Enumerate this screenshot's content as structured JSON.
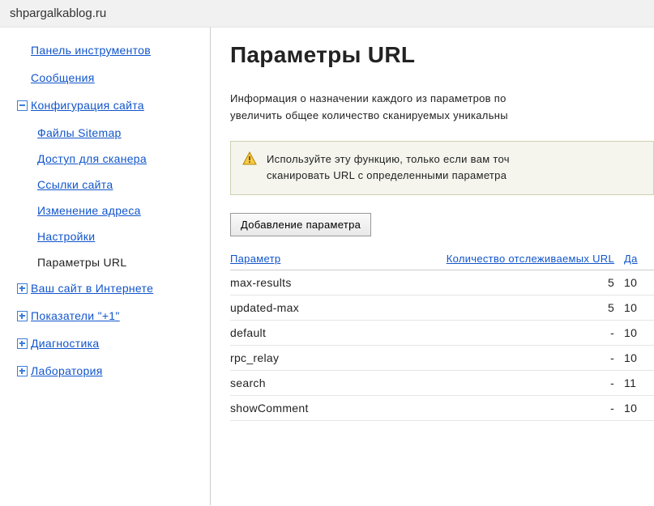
{
  "header": {
    "site": "shpargalkablog.ru"
  },
  "sidebar": {
    "items": [
      {
        "label": "Панель инструментов",
        "expand": null
      },
      {
        "label": "Сообщения",
        "expand": null
      },
      {
        "label": "Конфигурация сайта",
        "expand": "minus"
      },
      {
        "label": "Ваш сайт в Интернете",
        "expand": "plus"
      },
      {
        "label": "Показатели \"+1\"",
        "expand": "plus"
      },
      {
        "label": "Диагностика",
        "expand": "plus"
      },
      {
        "label": "Лаборатория",
        "expand": "plus"
      }
    ],
    "sub": [
      {
        "label": "Файлы Sitemap"
      },
      {
        "label": "Доступ для сканера"
      },
      {
        "label": "Ссылки сайта"
      },
      {
        "label": "Изменение адреса"
      },
      {
        "label": "Настройки"
      },
      {
        "label": "Параметры URL",
        "active": true
      }
    ]
  },
  "main": {
    "title": "Параметры URL",
    "intro_l1": "Информация о назначении каждого из параметров по",
    "intro_l2": "увеличить общее количество сканируемых уникальны",
    "notice_l1": "Используйте эту функцию, только если вам точ",
    "notice_l2": "сканировать URL с определенными параметра",
    "add_btn": "Добавление параметра",
    "columns": {
      "param": "Параметр",
      "count": "Количество отслеживаемых URL",
      "date": "Да"
    },
    "rows": [
      {
        "param": "max-results",
        "count": "5",
        "date": "10"
      },
      {
        "param": "updated-max",
        "count": "5",
        "date": "10"
      },
      {
        "param": "default",
        "count": "-",
        "date": "10"
      },
      {
        "param": "rpc_relay",
        "count": "-",
        "date": "10"
      },
      {
        "param": "search",
        "count": "-",
        "date": "11"
      },
      {
        "param": "showComment",
        "count": "-",
        "date": "10"
      }
    ]
  }
}
